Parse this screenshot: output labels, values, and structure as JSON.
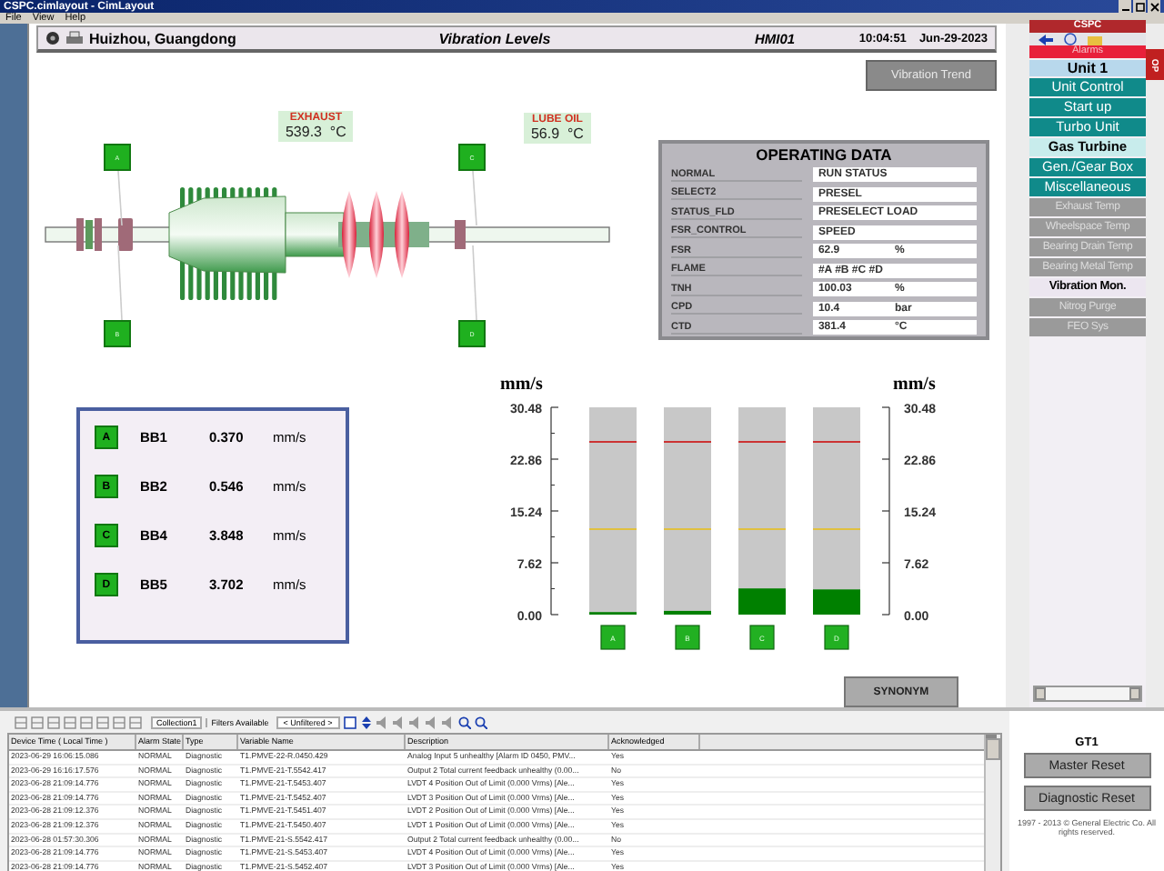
{
  "window": {
    "title": "CSPC.cimlayout - CimLayout"
  },
  "menu": [
    "File",
    "View",
    "Help"
  ],
  "header": {
    "location": "Huizhou, Guangdong",
    "title": "Vibration Levels",
    "station": "HMI01",
    "time": "10:04:51",
    "date": "Jun-29-2023"
  },
  "trend_button": "Vibration Trend",
  "synonym_button": "SYNONYM",
  "temperatures": [
    {
      "label": "EXHAUST",
      "value": "539.3",
      "unit": "°C"
    },
    {
      "label": "LUBE OIL",
      "value": "56.9",
      "unit": "°C"
    }
  ],
  "probes": [
    "A",
    "B",
    "C",
    "D"
  ],
  "operating_data": {
    "title": "OPERATING DATA",
    "rows": [
      {
        "name": "NORMAL",
        "value": "RUN STATUS"
      },
      {
        "name": "SELECT2",
        "value": "PRESEL"
      },
      {
        "name": "STATUS_FLD",
        "value": "PRESELECT LOAD"
      },
      {
        "name": "FSR_CONTROL",
        "value": "SPEED"
      },
      {
        "name": "FSR",
        "value": "62.9",
        "unit": "%"
      },
      {
        "name": "FLAME",
        "value": "#A #B #C #D"
      },
      {
        "name": "TNH",
        "value": "100.03",
        "unit": "%"
      },
      {
        "name": "CPD",
        "value": "10.4",
        "unit": "bar"
      },
      {
        "name": "CTD",
        "value": "381.4",
        "unit": "°C"
      }
    ]
  },
  "bearings": [
    {
      "probe": "A",
      "name": "BB1",
      "value": "0.370",
      "unit": "mm/s"
    },
    {
      "probe": "B",
      "name": "BB2",
      "value": "0.546",
      "unit": "mm/s"
    },
    {
      "probe": "C",
      "name": "BB4",
      "value": "3.848",
      "unit": "mm/s"
    },
    {
      "probe": "D",
      "name": "BB5",
      "value": "3.702",
      "unit": "mm/s"
    }
  ],
  "vibration_chart": {
    "right_ylabel": "mm/s",
    "chart_data": {
      "type": "bar",
      "ylabel": "mm/s",
      "categories": [
        "A",
        "B",
        "C",
        "D"
      ],
      "values": [
        0.37,
        0.546,
        3.848,
        3.702
      ],
      "yticks": [
        {
          "value": 0,
          "label": "0.00"
        },
        {
          "value": 7.62,
          "label": "7.62"
        },
        {
          "value": 15.24,
          "label": "15.24"
        },
        {
          "value": 22.86,
          "label": "22.86"
        },
        {
          "value": 30.48,
          "label": "30.48"
        }
      ],
      "ylim": [
        0,
        30.48
      ]
    },
    "limit_lines": [
      {
        "color": "#cc3333"
      },
      {
        "color": "#e0c040"
      }
    ]
  },
  "sidebar": {
    "title": "CSPC",
    "side_tab": "OP",
    "items": [
      {
        "label": "Alarms",
        "kind": "alarm",
        "selected": false
      },
      {
        "label": "Unit 1",
        "kind": "unit",
        "selected": false
      },
      {
        "label": "Unit Control",
        "kind": "nav",
        "selected": false
      },
      {
        "label": "Start up",
        "kind": "nav",
        "selected": false
      },
      {
        "label": "Turbo Unit",
        "kind": "nav",
        "selected": false
      },
      {
        "label": "Gas Turbine",
        "kind": "group",
        "selected": false
      },
      {
        "label": "Gen./Gear Box",
        "kind": "nav",
        "selected": false
      },
      {
        "label": "Miscellaneous",
        "kind": "nav",
        "selected": false
      },
      {
        "label": "Exhaust Temp",
        "kind": "page",
        "selected": false
      },
      {
        "label": "Wheelspace Temp",
        "kind": "page",
        "selected": false
      },
      {
        "label": "Bearing Drain Temp",
        "kind": "page",
        "selected": false
      },
      {
        "label": "Bearing Metal Temp",
        "kind": "page",
        "selected": false
      },
      {
        "label": "Vibration Mon.",
        "kind": "page",
        "selected": true
      },
      {
        "label": "Nitrog Purge",
        "kind": "page",
        "selected": false
      },
      {
        "label": "FEO Sys",
        "kind": "page",
        "selected": false
      }
    ]
  },
  "alarm_log": {
    "collection": "Collection1",
    "filters": "Filters Available",
    "filter_value": "< Unfiltered >",
    "columns": [
      "Device Time ( Local Time )",
      "Alarm State",
      "Type",
      "Variable Name",
      "Description",
      "Acknowledged"
    ],
    "rows": [
      [
        "2023-06-29 16:06:15.086",
        "NORMAL",
        "Diagnostic",
        "T1.PMVE-22-R.0450.429",
        "Analog Input 5 unhealthy [Alarm ID 0450, PMV...",
        "Yes"
      ],
      [
        "2023-06-29 16:16:17.576",
        "NORMAL",
        "Diagnostic",
        "T1.PMVE-21-T.5542.417",
        "Output 2 Total current feedback unhealthy (0.00...",
        "No"
      ],
      [
        "2023-06-28 21:09:14.776",
        "NORMAL",
        "Diagnostic",
        "T1.PMVE-21-T.5453.407",
        "LVDT 4 Position Out of Limit (0.000 Vrms) [Ale...",
        "Yes"
      ],
      [
        "2023-06-28 21:09:14.776",
        "NORMAL",
        "Diagnostic",
        "T1.PMVE-21-T.5452.407",
        "LVDT 3 Position Out of Limit (0.000 Vrms) [Ale...",
        "Yes"
      ],
      [
        "2023-06-28 21:09:12.376",
        "NORMAL",
        "Diagnostic",
        "T1.PMVE-21-T.5451.407",
        "LVDT 2 Position Out of Limit (0.000 Vrms) [Ale...",
        "Yes"
      ],
      [
        "2023-06-28 21:09:12.376",
        "NORMAL",
        "Diagnostic",
        "T1.PMVE-21-T.5450.407",
        "LVDT 1 Position Out of Limit (0.000 Vrms) [Ale...",
        "Yes"
      ],
      [
        "2023-06-28 01:57:30.306",
        "NORMAL",
        "Diagnostic",
        "T1.PMVE-21-S.5542.417",
        "Output 2 Total current feedback unhealthy (0.00...",
        "No"
      ],
      [
        "2023-06-28 21:09:14.776",
        "NORMAL",
        "Diagnostic",
        "T1.PMVE-21-S.5453.407",
        "LVDT 4 Position Out of Limit (0.000 Vrms) [Ale...",
        "Yes"
      ],
      [
        "2023-06-28 21:09:14.776",
        "NORMAL",
        "Diagnostic",
        "T1.PMVE-21-S.5452.407",
        "LVDT 3 Position Out of Limit (0.000 Vrms) [Ale...",
        "Yes"
      ]
    ]
  },
  "reset_panel": {
    "unit": "GT1",
    "buttons": [
      "Master Reset",
      "Diagnostic Reset"
    ],
    "copyright": "1997 - 2013 © General Electric Co. All rights reserved."
  }
}
